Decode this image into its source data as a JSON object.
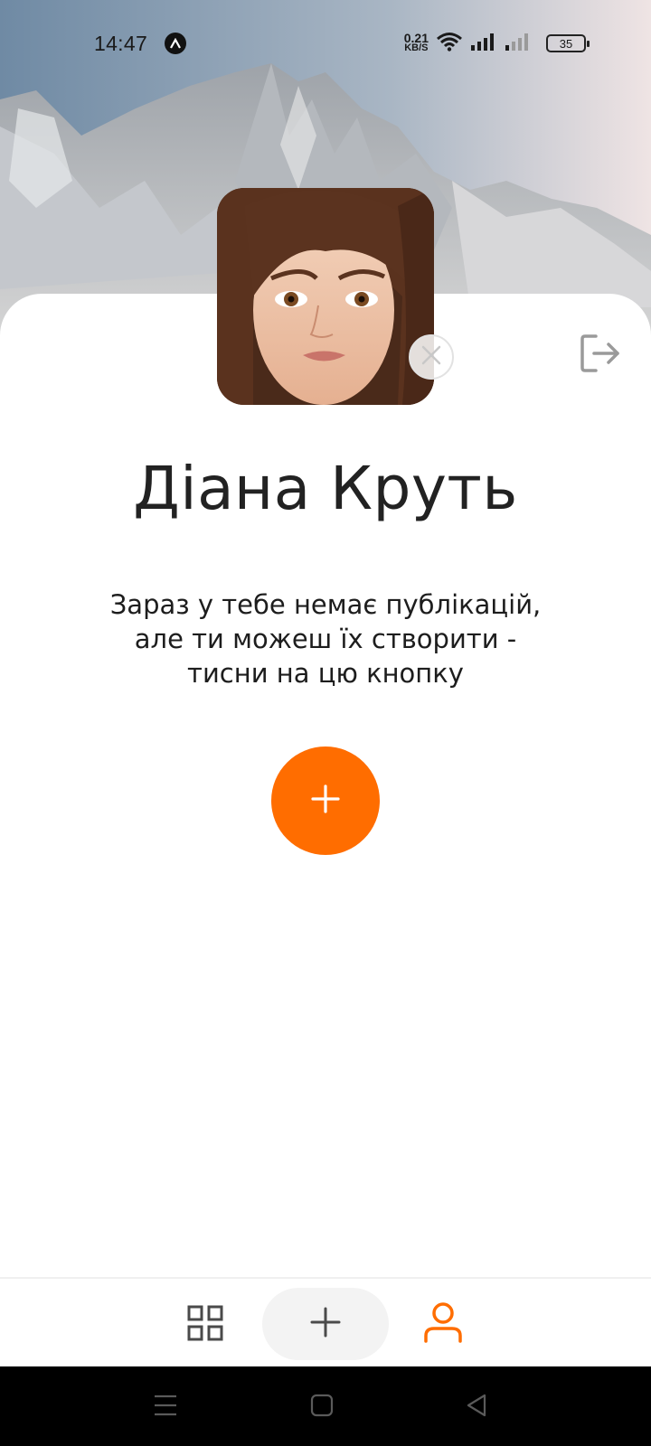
{
  "status_bar": {
    "time": "14:47",
    "net_speed_value": "0.21",
    "net_speed_unit": "KB/S",
    "battery": "35"
  },
  "profile": {
    "name": "Діана Круть",
    "empty_message": "Зараз у тебе немає публікацій, але ти можеш їх створити - тисни на цю кнопку"
  },
  "icons": {
    "status_app": "app-notification-icon",
    "wifi": "wifi-icon",
    "signal": "signal-icon",
    "remove_avatar": "close-icon",
    "logout": "logout-icon",
    "create": "plus-icon",
    "nav_feed": "grid-icon",
    "nav_add": "plus-icon",
    "nav_profile": "user-icon"
  },
  "colors": {
    "accent": "#ff6d00",
    "text": "#222222",
    "nav_inactive": "#4a4a4a",
    "background": "#ffffff"
  }
}
